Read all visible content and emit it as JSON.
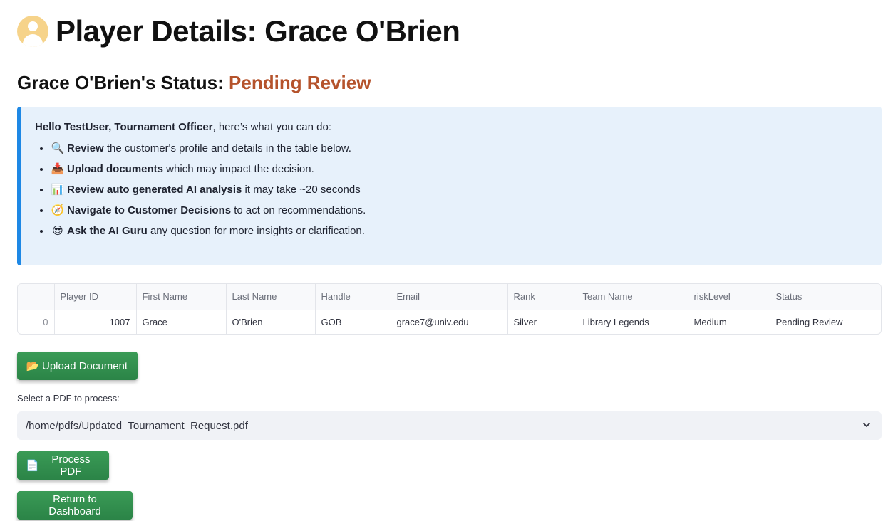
{
  "header": {
    "title": "Player Details: Grace O'Brien",
    "icon": "user-avatar-icon"
  },
  "status": {
    "label": "Grace O'Brien's Status:",
    "value": "Pending Review",
    "value_color": "#b5532c"
  },
  "info": {
    "greeting_bold": "Hello TestUser, Tournament Officer",
    "greeting_rest": ", here’s what you can do:",
    "items": [
      {
        "icon": "🔍",
        "icon_name": "magnifier-icon",
        "bold": "Review",
        "rest": " the customer's profile and details in the table below."
      },
      {
        "icon": "📥",
        "icon_name": "inbox-tray-icon",
        "bold": "Upload documents",
        "rest": " which may impact the decision."
      },
      {
        "icon": "📊",
        "icon_name": "bar-chart-icon",
        "bold": "Review auto generated AI analysis",
        "rest": " it may take ~20 seconds"
      },
      {
        "icon": "🧭",
        "icon_name": "compass-icon",
        "bold": "Navigate to Customer Decisions",
        "rest": " to act on recommendations."
      },
      {
        "icon": "😎",
        "icon_name": "guru-face-icon",
        "bold": "Ask the AI Guru",
        "rest": " any question for more insights or clarification."
      }
    ]
  },
  "table": {
    "columns": [
      "",
      "Player ID",
      "First Name",
      "Last Name",
      "Handle",
      "Email",
      "Rank",
      "Team Name",
      "riskLevel",
      "Status"
    ],
    "rows": [
      [
        "0",
        "1007",
        "Grace",
        "O'Brien",
        "GOB",
        "grace7@univ.edu",
        "Silver",
        "Library Legends",
        "Medium",
        "Pending Review"
      ]
    ]
  },
  "buttons": {
    "upload": {
      "icon": "📂",
      "label": "Upload Document"
    },
    "process": {
      "icon": "📄",
      "label": "Process PDF"
    },
    "return": {
      "label": "Return to Dashboard"
    }
  },
  "pdf_select": {
    "label": "Select a PDF to process:",
    "value": "/home/pdfs/Updated_Tournament_Request.pdf"
  },
  "colors": {
    "accent_green": "#2b8447",
    "info_border": "#1e88e5",
    "info_bg": "#e7f1fb"
  }
}
